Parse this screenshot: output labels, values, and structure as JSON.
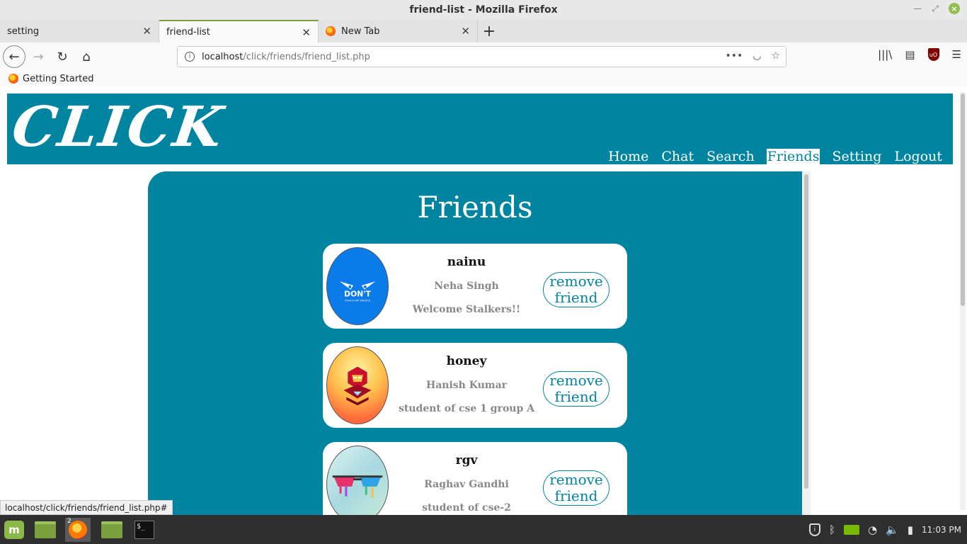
{
  "window": {
    "title": "friend-list - Mozilla Firefox"
  },
  "tabs": [
    {
      "label": "setting",
      "active": false
    },
    {
      "label": "friend-list",
      "active": true
    },
    {
      "label": "New Tab",
      "active": false
    }
  ],
  "url": {
    "host": "localhost",
    "path": "/click/friends/friend_list.php"
  },
  "bookmarks": [
    {
      "label": "Getting Started"
    }
  ],
  "site": {
    "logo": "CLICK",
    "nav": [
      "Home",
      "Chat",
      "Search",
      "Friends",
      "Setting",
      "Logout"
    ],
    "active_nav": "Friends",
    "accent": "#00849f"
  },
  "page": {
    "heading": "Friends",
    "friends": [
      {
        "username": "nainu",
        "full_name": "Neha Singh",
        "bio": "Welcome Stalkers!!",
        "avatar_text": "DON'T",
        "avatar_subtext": "TOUCH MY DEVICE",
        "button": "remove friend"
      },
      {
        "username": "honey",
        "full_name": "Hanish Kumar",
        "bio": "student of cse 1 group A",
        "button": "remove friend"
      },
      {
        "username": "rgv",
        "full_name": "Raghav Gandhi",
        "bio": "student of cse-2",
        "button": "remove friend"
      }
    ]
  },
  "status_link": "localhost/click/friends/friend_list.php#",
  "taskbar": {
    "firefox_count": "2",
    "clock": "11:03 PM",
    "terminal_text": "$_"
  }
}
